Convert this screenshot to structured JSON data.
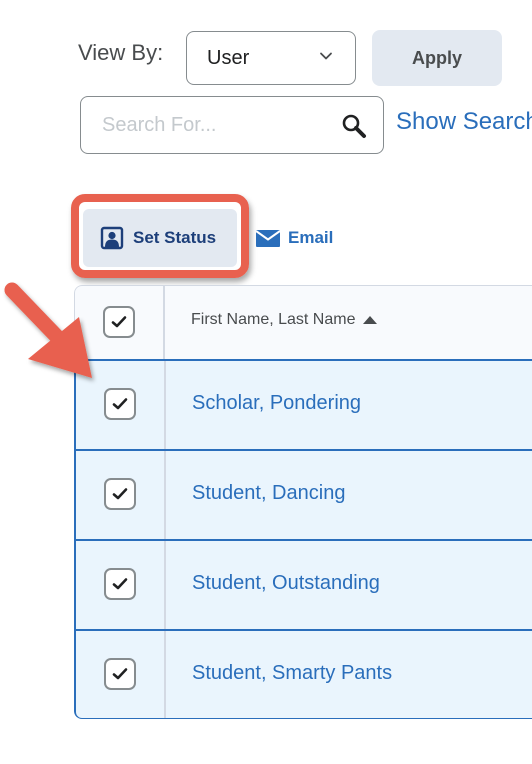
{
  "filters": {
    "view_by_label": "View By:",
    "view_by_selected": "User",
    "apply_label": "Apply",
    "search_placeholder": "Search For...",
    "search_value": "",
    "show_search_options_label": "Show Search"
  },
  "actions": {
    "set_status_label": "Set Status",
    "email_label": "Email"
  },
  "table": {
    "column_header": "First Name, Last Name",
    "sort_direction": "ascending",
    "header_checkbox_checked": true,
    "rows": [
      {
        "name": "Scholar, Pondering",
        "checked": true
      },
      {
        "name": "Student, Dancing",
        "checked": true
      },
      {
        "name": "Student, Outstanding",
        "checked": true
      },
      {
        "name": "Student, Smarty Pants",
        "checked": true
      }
    ]
  },
  "annotation": {
    "highlight_color": "#e8614f",
    "accent_color": "#2a6ebb"
  }
}
